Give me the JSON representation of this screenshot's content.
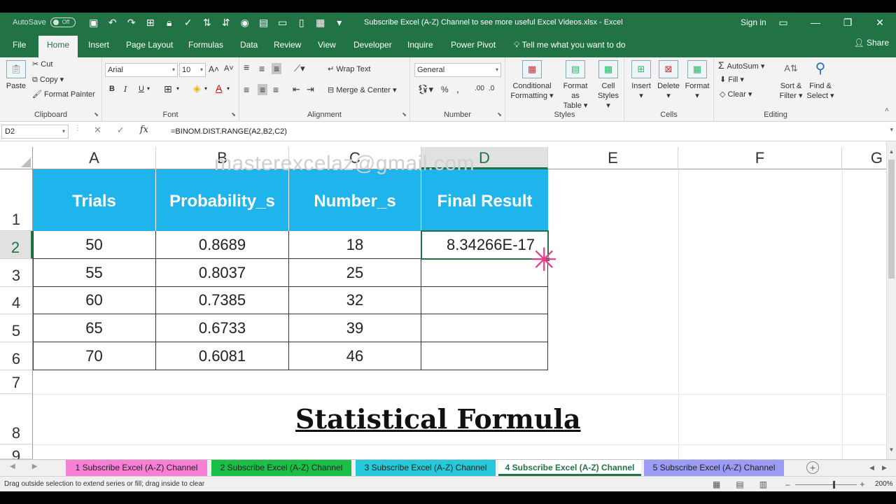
{
  "titlebar": {
    "autosave_label": "AutoSave",
    "autosave_state": "Off",
    "doc_title": "Subscribe Excel (A-Z) Channel to see more useful Excel Videos.xlsx  -  Excel",
    "sign_in": "Sign in"
  },
  "tabs": [
    "File",
    "Home",
    "Insert",
    "Page Layout",
    "Formulas",
    "Data",
    "Review",
    "View",
    "Developer",
    "Inquire",
    "Power Pivot"
  ],
  "tell_me": "Tell me what you want to do",
  "share": "Share",
  "ribbon": {
    "clipboard": {
      "paste": "Paste",
      "cut": "Cut",
      "copy": "Copy",
      "format_painter": "Format Painter",
      "label": "Clipboard"
    },
    "font": {
      "name": "Arial",
      "size": "10",
      "bold": "B",
      "italic": "I",
      "underline": "U",
      "label": "Font"
    },
    "alignment": {
      "wrap_text": "Wrap Text",
      "merge_center": "Merge & Center",
      "label": "Alignment"
    },
    "number": {
      "format": "General",
      "percent": "%",
      "comma": ",",
      "label": "Number"
    },
    "styles": {
      "conditional": "Conditional",
      "formatting": "Formatting",
      "format_as": "Format as",
      "table": "Table",
      "cell": "Cell",
      "cell_styles": "Styles",
      "label": "Styles"
    },
    "cells": {
      "insert": "Insert",
      "delete": "Delete",
      "format": "Format",
      "label": "Cells"
    },
    "editing": {
      "autosum": "AutoSum",
      "fill": "Fill",
      "clear": "Clear",
      "sort": "Sort &",
      "filter": "Filter",
      "find": "Find &",
      "select": "Select",
      "label": "Editing"
    }
  },
  "formula_bar": {
    "name_box": "D2",
    "formula": "=BINOM.DIST.RANGE(A2,B2,C2)"
  },
  "columns": [
    "A",
    "B",
    "C",
    "D",
    "E",
    "F",
    "G"
  ],
  "rows": [
    "1",
    "2",
    "3",
    "4",
    "5",
    "6",
    "7",
    "8",
    "9"
  ],
  "watermark": "masterexcelaz@gmail.com",
  "table": {
    "headers": [
      "Trials",
      "Probability_s",
      "Number_s",
      "Final Result"
    ],
    "rows": [
      [
        "50",
        "0.8689",
        "18",
        "8.34266E-17"
      ],
      [
        "55",
        "0.8037",
        "25",
        ""
      ],
      [
        "60",
        "0.7385",
        "32",
        ""
      ],
      [
        "65",
        "0.6733",
        "39",
        ""
      ],
      [
        "70",
        "0.6081",
        "46",
        ""
      ]
    ]
  },
  "title": "Statistical Formula",
  "sheets": [
    {
      "label": "1 Subscribe Excel (A-Z) Channel",
      "color": "#f77fd6"
    },
    {
      "label": "2 Subscribe Excel (A-Z) Channel",
      "color": "#19bf46"
    },
    {
      "label": "3 Subscribe Excel (A-Z) Channel",
      "color": "#25c9d9"
    },
    {
      "label": "4 Subscribe Excel (A-Z) Channel",
      "color": "#ffffff"
    },
    {
      "label": "5 Subscribe Excel (A-Z) Channel",
      "color": "#9c9cf4"
    }
  ],
  "status": {
    "message": "Drag outside selection to extend series or fill; drag inside to clear",
    "zoom": "200%"
  },
  "colors": {
    "excel_green": "#217346",
    "header_blue": "#1fb5ec",
    "cursor_pink": "#e83c8a"
  }
}
